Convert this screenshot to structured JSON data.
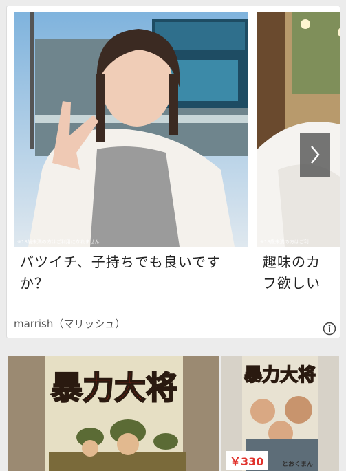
{
  "ad": {
    "slides": [
      {
        "title": "バツイチ、子持ちでも良いですか？",
        "disclaimer": "※18歳未満の方はご利用になれません"
      },
      {
        "title": "趣味のカフ欲しい",
        "disclaimer": "※18歳未満の方はご利"
      }
    ],
    "sponsor": "marrish（マリッシュ）",
    "next_icon": "chevron-right-icon",
    "info_icon": "info-icon"
  },
  "manga": {
    "items": [
      {
        "title_art": "暴力大将"
      },
      {
        "title_art": "暴力大将",
        "price": "￥330",
        "caption": "とおくまん"
      }
    ]
  }
}
